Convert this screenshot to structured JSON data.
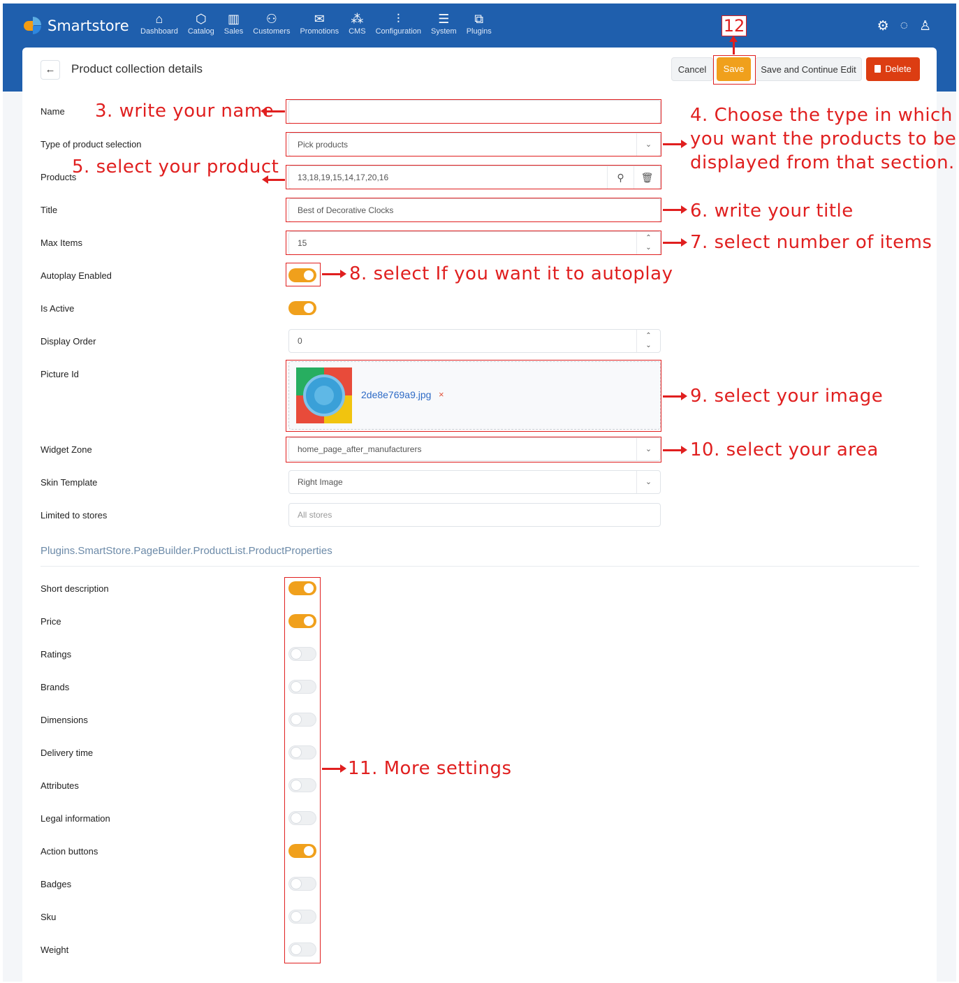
{
  "app": {
    "name": "Smartstore"
  },
  "nav": [
    {
      "label": "Dashboard",
      "icon": "home-icon"
    },
    {
      "label": "Catalog",
      "icon": "box-icon"
    },
    {
      "label": "Sales",
      "icon": "chart-icon"
    },
    {
      "label": "Customers",
      "icon": "users-icon"
    },
    {
      "label": "Promotions",
      "icon": "megaphone-icon"
    },
    {
      "label": "CMS",
      "icon": "sitemap-icon"
    },
    {
      "label": "Configuration",
      "icon": "sliders-icon"
    },
    {
      "label": "System",
      "icon": "database-icon"
    },
    {
      "label": "Plugins",
      "icon": "puzzle-icon"
    }
  ],
  "header": {
    "title": "Product collection details",
    "cancel": "Cancel",
    "save": "Save",
    "save_continue": "Save and Continue Edit",
    "delete": "Delete"
  },
  "form": {
    "name": {
      "label": "Name",
      "value": ""
    },
    "selection_type": {
      "label": "Type of product selection",
      "value": "Pick products"
    },
    "products": {
      "label": "Products",
      "value": "13,18,19,15,14,17,20,16"
    },
    "title": {
      "label": "Title",
      "value": "Best of Decorative Clocks"
    },
    "max_items": {
      "label": "Max Items",
      "value": "15"
    },
    "autoplay": {
      "label": "Autoplay Enabled",
      "on": true
    },
    "is_active": {
      "label": "Is Active",
      "on": true
    },
    "display_order": {
      "label": "Display Order",
      "value": "0"
    },
    "picture": {
      "label": "Picture Id",
      "file": "2de8e769a9.jpg",
      "remove": "×"
    },
    "widget_zone": {
      "label": "Widget Zone",
      "value": "home_page_after_manufacturers"
    },
    "skin_template": {
      "label": "Skin Template",
      "value": "Right Image"
    },
    "limited_stores": {
      "label": "Limited to stores",
      "placeholder": "All stores"
    }
  },
  "properties": {
    "title": "Plugins.SmartStore.PageBuilder.ProductList.ProductProperties",
    "items": [
      {
        "label": "Short description",
        "on": true
      },
      {
        "label": "Price",
        "on": true
      },
      {
        "label": "Ratings",
        "on": false
      },
      {
        "label": "Brands",
        "on": false
      },
      {
        "label": "Dimensions",
        "on": false
      },
      {
        "label": "Delivery time",
        "on": false
      },
      {
        "label": "Attributes",
        "on": false
      },
      {
        "label": "Legal information",
        "on": false
      },
      {
        "label": "Action buttons",
        "on": true
      },
      {
        "label": "Badges",
        "on": false
      },
      {
        "label": "Sku",
        "on": false
      },
      {
        "label": "Weight",
        "on": false
      }
    ]
  },
  "annotations": {
    "a3": "3. write your name",
    "a4_1": "4. Choose the type in which",
    "a4_2": "you want the products to be",
    "a4_3": "displayed from that section.",
    "a5": "5. select your product",
    "a6": "6. write your title",
    "a7": "7. select number of items",
    "a8": "8. select If you want it to autoplay",
    "a9": "9. select your image",
    "a10": "10. select your area",
    "a11": "11. More settings",
    "a12": "12"
  },
  "colors": {
    "brand": "#1f5fad",
    "accent": "#f0a01c",
    "danger": "#dc3d12",
    "annotation": "#e01f1f"
  }
}
